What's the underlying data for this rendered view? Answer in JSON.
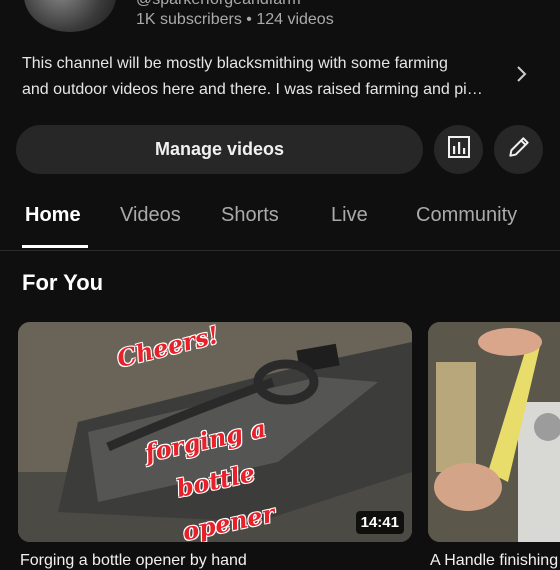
{
  "channel": {
    "handle": "@sparkerforgeandfarm",
    "stats": "1K subscribers • 124 videos",
    "description_line1": "This channel will be mostly blacksmithing with some farming",
    "description_line2": "and outdoor videos here and there. I was raised farming and pi…"
  },
  "actions": {
    "manage_videos": "Manage videos",
    "analytics_icon": "analytics-icon",
    "edit_icon": "pencil-icon"
  },
  "tabs": [
    {
      "label": "Home",
      "active": true
    },
    {
      "label": "Videos",
      "active": false
    },
    {
      "label": "Shorts",
      "active": false
    },
    {
      "label": "Live",
      "active": false
    },
    {
      "label": "Community",
      "active": false
    }
  ],
  "section": {
    "title": "For You"
  },
  "videos": [
    {
      "duration": "14:41",
      "overlay_1": "Cheers!",
      "overlay_2": "forging a",
      "overlay_3": "bottle",
      "overlay_4": "opener",
      "title": "Forging a bottle opener by hand"
    },
    {
      "title": "A Handle finishing"
    }
  ],
  "colors": {
    "background": "#0f0f0f",
    "button": "#272727",
    "text_secondary": "#aaaaaa",
    "overlay_red": "#e8202a"
  }
}
